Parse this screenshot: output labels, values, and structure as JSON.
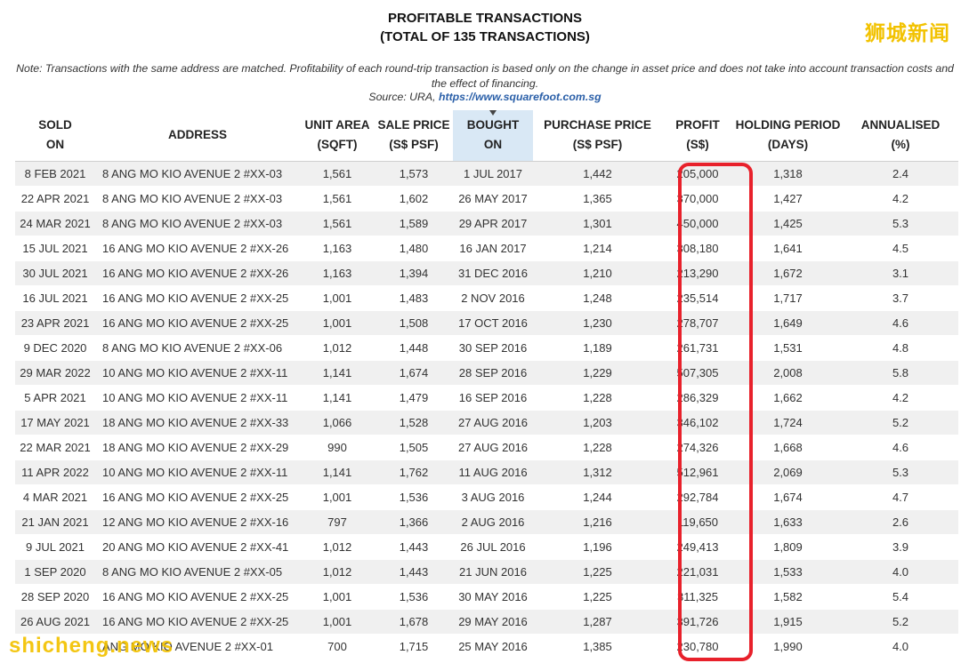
{
  "title": {
    "line1": "PROFITABLE TRANSACTIONS",
    "line2": "(TOTAL OF 135 TRANSACTIONS)"
  },
  "note": "Note: Transactions with the same address are matched. Profitability of each round-trip transaction is based only on the change in asset price and does not take into account transaction costs and the effect of financing.",
  "source": {
    "prefix": "Source: URA, ",
    "link": "https://www.squarefoot.com.sg"
  },
  "watermarks": {
    "top_right": "狮城新闻",
    "bottom_left": "shicheng.news"
  },
  "highlight_color": "#e8212b",
  "columns": [
    {
      "line1": "SOLD",
      "line2": "ON"
    },
    {
      "line1": "ADDRESS",
      "line2": ""
    },
    {
      "line1": "UNIT AREA",
      "line2": "(SQFT)"
    },
    {
      "line1": "SALE PRICE",
      "line2": "(S$ PSF)"
    },
    {
      "line1": "BOUGHT",
      "line2": "ON"
    },
    {
      "line1": "PURCHASE PRICE",
      "line2": "(S$ PSF)"
    },
    {
      "line1": "PROFIT",
      "line2": "(S$)"
    },
    {
      "line1": "HOLDING PERIOD",
      "line2": "(DAYS)"
    },
    {
      "line1": "ANNUALISED",
      "line2": "(%)"
    }
  ],
  "rows": [
    [
      "8 FEB 2021",
      "8 ANG MO KIO AVENUE 2 #XX-03",
      "1,561",
      "1,573",
      "1 JUL 2017",
      "1,442",
      "205,000",
      "1,318",
      "2.4"
    ],
    [
      "22 APR 2021",
      "8 ANG MO KIO AVENUE 2 #XX-03",
      "1,561",
      "1,602",
      "26 MAY 2017",
      "1,365",
      "370,000",
      "1,427",
      "4.2"
    ],
    [
      "24 MAR 2021",
      "8 ANG MO KIO AVENUE 2 #XX-03",
      "1,561",
      "1,589",
      "29 APR 2017",
      "1,301",
      "450,000",
      "1,425",
      "5.3"
    ],
    [
      "15 JUL 2021",
      "16 ANG MO KIO AVENUE 2 #XX-26",
      "1,163",
      "1,480",
      "16 JAN 2017",
      "1,214",
      "308,180",
      "1,641",
      "4.5"
    ],
    [
      "30 JUL 2021",
      "16 ANG MO KIO AVENUE 2 #XX-26",
      "1,163",
      "1,394",
      "31 DEC 2016",
      "1,210",
      "213,290",
      "1,672",
      "3.1"
    ],
    [
      "16 JUL 2021",
      "16 ANG MO KIO AVENUE 2 #XX-25",
      "1,001",
      "1,483",
      "2 NOV 2016",
      "1,248",
      "235,514",
      "1,717",
      "3.7"
    ],
    [
      "23 APR 2021",
      "16 ANG MO KIO AVENUE 2 #XX-25",
      "1,001",
      "1,508",
      "17 OCT 2016",
      "1,230",
      "278,707",
      "1,649",
      "4.6"
    ],
    [
      "9 DEC 2020",
      "8 ANG MO KIO AVENUE 2 #XX-06",
      "1,012",
      "1,448",
      "30 SEP 2016",
      "1,189",
      "261,731",
      "1,531",
      "4.8"
    ],
    [
      "29 MAR 2022",
      "10 ANG MO KIO AVENUE 2 #XX-11",
      "1,141",
      "1,674",
      "28 SEP 2016",
      "1,229",
      "507,305",
      "2,008",
      "5.8"
    ],
    [
      "5 APR 2021",
      "10 ANG MO KIO AVENUE 2 #XX-11",
      "1,141",
      "1,479",
      "16 SEP 2016",
      "1,228",
      "286,329",
      "1,662",
      "4.2"
    ],
    [
      "17 MAY 2021",
      "18 ANG MO KIO AVENUE 2 #XX-33",
      "1,066",
      "1,528",
      "27 AUG 2016",
      "1,203",
      "346,102",
      "1,724",
      "5.2"
    ],
    [
      "22 MAR 2021",
      "18 ANG MO KIO AVENUE 2 #XX-29",
      "990",
      "1,505",
      "27 AUG 2016",
      "1,228",
      "274,326",
      "1,668",
      "4.6"
    ],
    [
      "11 APR 2022",
      "10 ANG MO KIO AVENUE 2 #XX-11",
      "1,141",
      "1,762",
      "11 AUG 2016",
      "1,312",
      "512,961",
      "2,069",
      "5.3"
    ],
    [
      "4 MAR 2021",
      "16 ANG MO KIO AVENUE 2 #XX-25",
      "1,001",
      "1,536",
      "3 AUG 2016",
      "1,244",
      "292,784",
      "1,674",
      "4.7"
    ],
    [
      "21 JAN 2021",
      "12 ANG MO KIO AVENUE 2 #XX-16",
      "797",
      "1,366",
      "2 AUG 2016",
      "1,216",
      "119,650",
      "1,633",
      "2.6"
    ],
    [
      "9 JUL 2021",
      "20 ANG MO KIO AVENUE 2 #XX-41",
      "1,012",
      "1,443",
      "26 JUL 2016",
      "1,196",
      "249,413",
      "1,809",
      "3.9"
    ],
    [
      "1 SEP 2020",
      "8 ANG MO KIO AVENUE 2 #XX-05",
      "1,012",
      "1,443",
      "21 JUN 2016",
      "1,225",
      "221,031",
      "1,533",
      "4.0"
    ],
    [
      "28 SEP 2020",
      "16 ANG MO KIO AVENUE 2 #XX-25",
      "1,001",
      "1,536",
      "30 MAY 2016",
      "1,225",
      "311,325",
      "1,582",
      "5.4"
    ],
    [
      "26 AUG 2021",
      "16 ANG MO KIO AVENUE 2 #XX-25",
      "1,001",
      "1,678",
      "29 MAY 2016",
      "1,287",
      "391,726",
      "1,915",
      "5.2"
    ],
    [
      "",
      "ANG MO KIO AVENUE 2 #XX-01",
      "700",
      "1,715",
      "25 MAY 2016",
      "1,385",
      "230,780",
      "1,990",
      "4.0"
    ]
  ]
}
